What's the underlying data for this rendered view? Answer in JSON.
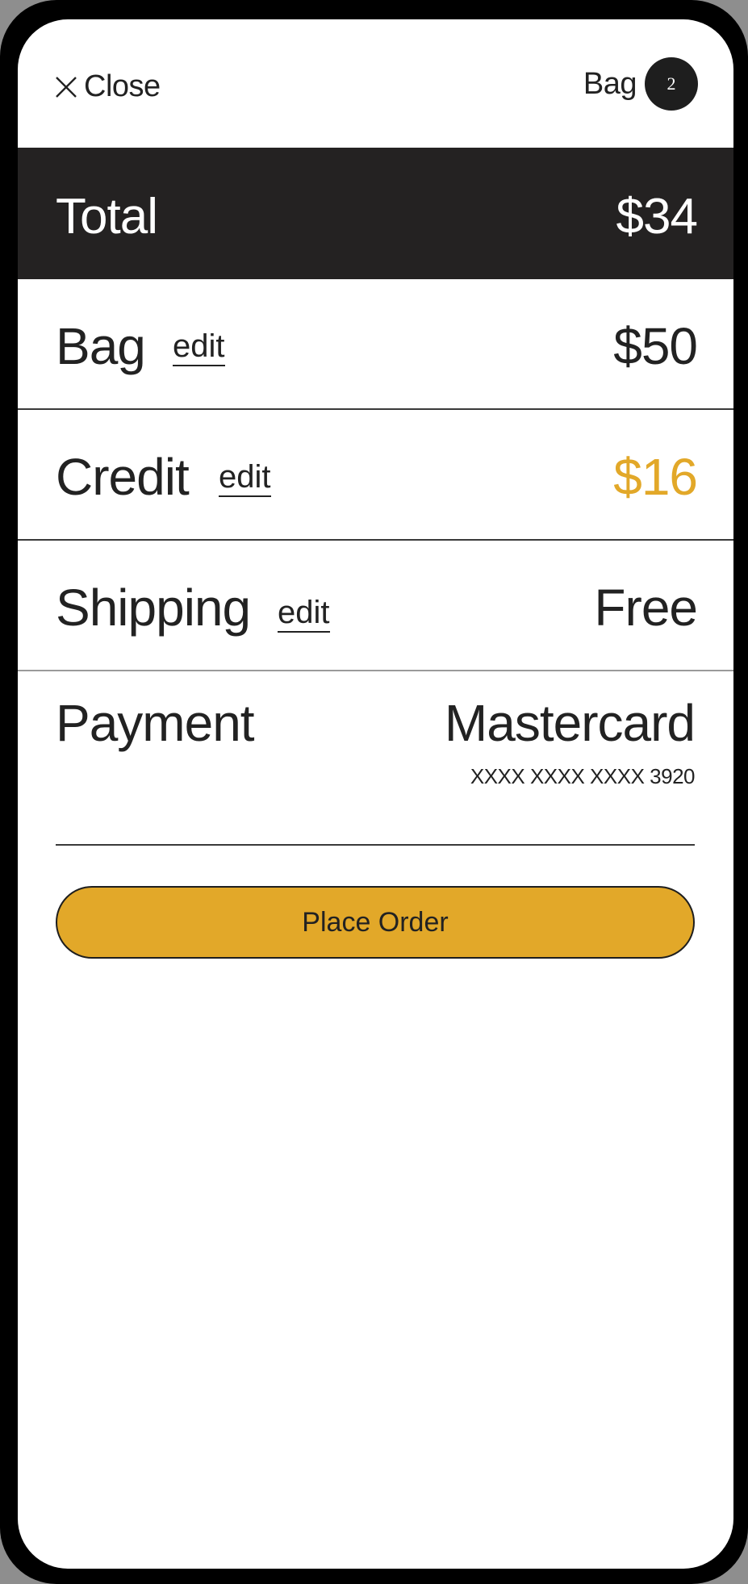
{
  "header": {
    "close_label": "Close",
    "bag_label": "Bag",
    "bag_count": "2"
  },
  "total": {
    "label": "Total",
    "value": "$34"
  },
  "rows": {
    "bag": {
      "label": "Bag",
      "edit": "edit",
      "value": "$50"
    },
    "credit": {
      "label": "Credit",
      "edit": "edit",
      "value": "$16"
    },
    "shipping": {
      "label": "Shipping",
      "edit": "edit",
      "value": "Free"
    }
  },
  "payment": {
    "label": "Payment",
    "method": "Mastercard",
    "card_number": "XXXX XXXX XXXX 3920"
  },
  "action": {
    "place_order_label": "Place Order"
  },
  "colors": {
    "accent": "#e2a829",
    "dark": "#242222"
  },
  "icons": {
    "close": "close-icon"
  }
}
